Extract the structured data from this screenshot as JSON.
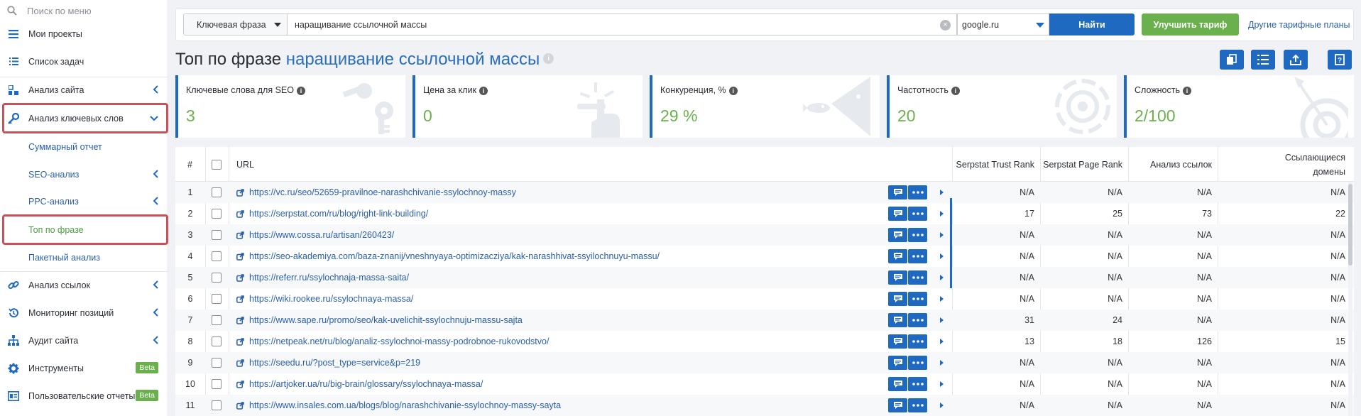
{
  "sidebar": {
    "search_placeholder": "Поиск по меню",
    "items": [
      {
        "label": "Мои проекты",
        "icon": "menu-icon"
      },
      {
        "label": "Список задач",
        "icon": "list-icon"
      },
      {
        "label": "Анализ сайта",
        "icon": "site-analysis-icon"
      },
      {
        "label": "Анализ ключевых слов",
        "icon": "key-icon"
      },
      {
        "label": "Анализ ссылок",
        "icon": "link-icon"
      },
      {
        "label": "Мониторинг позиций",
        "icon": "history-icon"
      },
      {
        "label": "Аудит сайта",
        "icon": "sitemap-icon"
      },
      {
        "label": "Инструменты",
        "icon": "gear-icon",
        "badge": "Beta"
      },
      {
        "label": "Пользовательские отчеты",
        "icon": "report-icon",
        "badge": "Beta"
      }
    ],
    "subitems": [
      {
        "label": "Суммарный отчет"
      },
      {
        "label": "SEO-анализ"
      },
      {
        "label": "PPC-анализ"
      },
      {
        "label": "Топ по фразе"
      },
      {
        "label": "Пакетный анализ"
      }
    ]
  },
  "topbar": {
    "search_type": "Ключевая фраза",
    "query": "наращивание ссылочной массы",
    "search_engine": "google.ru",
    "find_label": "Найти",
    "upgrade_label": "Улучшить тариф",
    "other_plans_label": "Другие тарифные планы"
  },
  "title": {
    "prefix": "Топ по фразе",
    "keyword": "наращивание ссылочной массы",
    "info": "i"
  },
  "cards": [
    {
      "label": "Ключевые слова для SEO",
      "value": "3"
    },
    {
      "label": "Цена за клик",
      "value": "0"
    },
    {
      "label": "Конкуренция, %",
      "value": "29 %"
    },
    {
      "label": "Частотность",
      "value": "20"
    },
    {
      "label": "Сложность",
      "value": "2/100"
    }
  ],
  "table": {
    "headers": {
      "num": "#",
      "url": "URL",
      "trust": "Serpstat Trust Rank",
      "page": "Serpstat Page Rank",
      "links": "Анализ ссылок",
      "domains_1": "Ссылающиеся",
      "domains_2": "домены"
    },
    "rows": [
      {
        "n": "1",
        "url": "https://vc.ru/seo/52659-pravilnoe-narashchivanie-ssylochnoy-massy",
        "trust": "N/A",
        "page": "N/A",
        "links": "N/A",
        "domains": "N/A"
      },
      {
        "n": "2",
        "url": "https://serpstat.com/ru/blog/right-link-building/",
        "trust": "17",
        "page": "25",
        "links": "73",
        "domains": "22"
      },
      {
        "n": "3",
        "url": "https://www.cossa.ru/artisan/260423/",
        "trust": "N/A",
        "page": "N/A",
        "links": "N/A",
        "domains": "N/A"
      },
      {
        "n": "4",
        "url": "https://seo-akademiya.com/baza-znanij/vneshnyaya-optimizacziya/kak-narashhivat-ssyilochnuyu-massu/",
        "trust": "N/A",
        "page": "N/A",
        "links": "N/A",
        "domains": "N/A"
      },
      {
        "n": "5",
        "url": "https://referr.ru/ssylochnaja-massa-saita/",
        "trust": "N/A",
        "page": "N/A",
        "links": "N/A",
        "domains": "N/A"
      },
      {
        "n": "6",
        "url": "https://wiki.rookee.ru/ssylochnaya-massa/",
        "trust": "N/A",
        "page": "N/A",
        "links": "N/A",
        "domains": "N/A"
      },
      {
        "n": "7",
        "url": "https://www.sape.ru/promo/seo/kak-uvelichit-ssylochnuju-massu-sajta",
        "trust": "31",
        "page": "24",
        "links": "N/A",
        "domains": "N/A"
      },
      {
        "n": "8",
        "url": "https://netpeak.net/ru/blog/analiz-ssylochnoi-massy-podrobnoe-rukovodstvo/",
        "trust": "13",
        "page": "18",
        "links": "126",
        "domains": "15"
      },
      {
        "n": "9",
        "url": "https://seedu.ru/?post_type=service&p=219",
        "trust": "N/A",
        "page": "N/A",
        "links": "N/A",
        "domains": "N/A"
      },
      {
        "n": "10",
        "url": "https://artjoker.ua/ru/big-brain/glossary/ssylochnaya-massa/",
        "trust": "N/A",
        "page": "N/A",
        "links": "N/A",
        "domains": "N/A"
      },
      {
        "n": "11",
        "url": "https://www.insales.com.ua/blogs/blog/narashchivanie-ssylochnoy-massy-sayta",
        "trust": "N/A",
        "page": "N/A",
        "links": "N/A",
        "domains": "N/A"
      }
    ]
  },
  "colors": {
    "accent": "#1f69c0",
    "green": "#6ab04c",
    "highlight": "#c9525a"
  }
}
